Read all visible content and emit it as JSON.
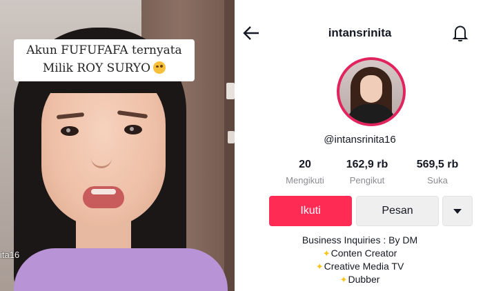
{
  "video": {
    "caption_line1": "Akun FUFUFAFA ternyata",
    "caption_line2": "Milik ROY SURYO",
    "caption_emoji": "rolling-on-floor-laughing-emoji",
    "watermark": "ita16"
  },
  "profile": {
    "username": "intansrinita",
    "handle": "@intansrinita16",
    "stats": [
      {
        "value": "20",
        "label": "Mengikuti"
      },
      {
        "value": "162,9 rb",
        "label": "Pengikut"
      },
      {
        "value": "569,5 rb",
        "label": "Suka"
      }
    ],
    "follow_label": "Ikuti",
    "message_label": "Pesan",
    "bio": [
      "Business Inquiries : By DM",
      "Conten Creator",
      "Creative Media TV",
      "Dubber"
    ],
    "bio_icon": "sparkles-icon",
    "colors": {
      "accent": "#fe2c55",
      "avatar_ring": "#e1245e"
    }
  }
}
